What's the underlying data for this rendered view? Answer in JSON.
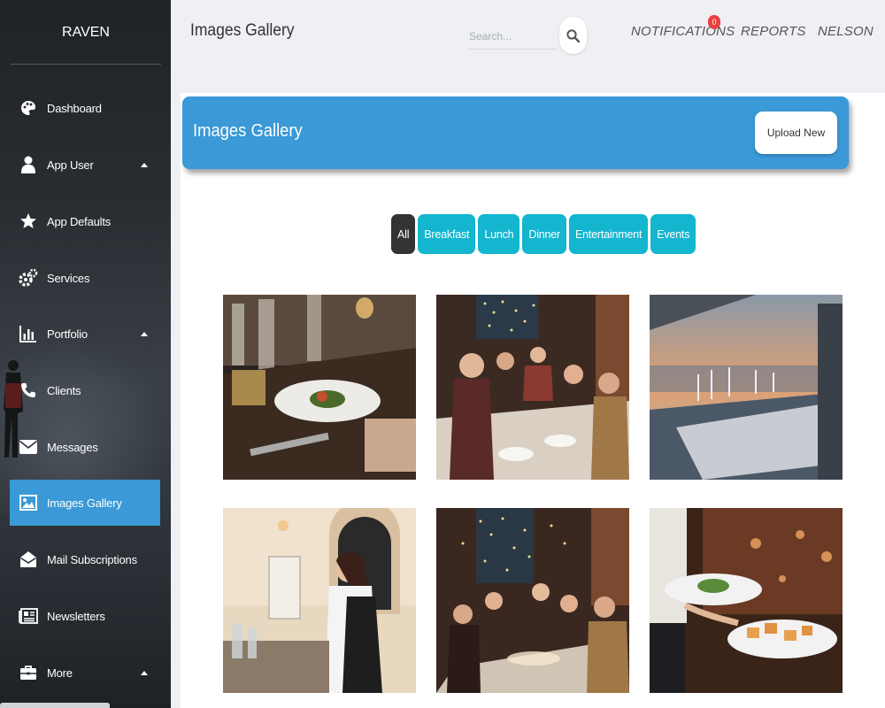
{
  "app": {
    "brand": "RAVEN"
  },
  "header": {
    "title": "Images Gallery",
    "search_placeholder": "Search...",
    "links": {
      "notifications": "NOTIFICATIONS",
      "reports": "REPORTS",
      "user": "NELSON"
    },
    "notification_count": "0"
  },
  "sidebar": {
    "items": [
      {
        "label": "Dashboard",
        "icon": "palette-icon"
      },
      {
        "label": "App User",
        "icon": "user-icon",
        "expandable": true
      },
      {
        "label": "App Defaults",
        "icon": "star-icon"
      },
      {
        "label": "Services",
        "icon": "gears-icon"
      },
      {
        "label": "Portfolio",
        "icon": "bar-chart-icon",
        "expandable": true
      },
      {
        "label": "Clients",
        "icon": "phone-icon"
      },
      {
        "label": "Messages",
        "icon": "envelope-icon"
      },
      {
        "label": "Images Gallery",
        "icon": "image-icon",
        "active": true
      },
      {
        "label": "Mail Subscriptions",
        "icon": "envelope-open-icon"
      },
      {
        "label": "Newsletters",
        "icon": "newspaper-icon"
      },
      {
        "label": "More",
        "icon": "briefcase-icon",
        "expandable": true
      }
    ]
  },
  "main": {
    "banner_title": "Images Gallery",
    "upload_label": "Upload New",
    "filters": [
      "All",
      "Breakfast",
      "Lunch",
      "Dinner",
      "Entertainment",
      "Events"
    ],
    "selected_filter": "All",
    "gallery": [
      {
        "subject": "plated-dinner-table"
      },
      {
        "subject": "group-selfie-dinner"
      },
      {
        "subject": "terrace-sunset-table"
      },
      {
        "subject": "waitress-at-bar"
      },
      {
        "subject": "festive-dinner-party"
      },
      {
        "subject": "waiter-serving-plates"
      }
    ]
  },
  "colors": {
    "accent": "#3a99d6",
    "filter": "#14b5cf",
    "filter_selected": "#333333",
    "badge": "#e84141"
  }
}
